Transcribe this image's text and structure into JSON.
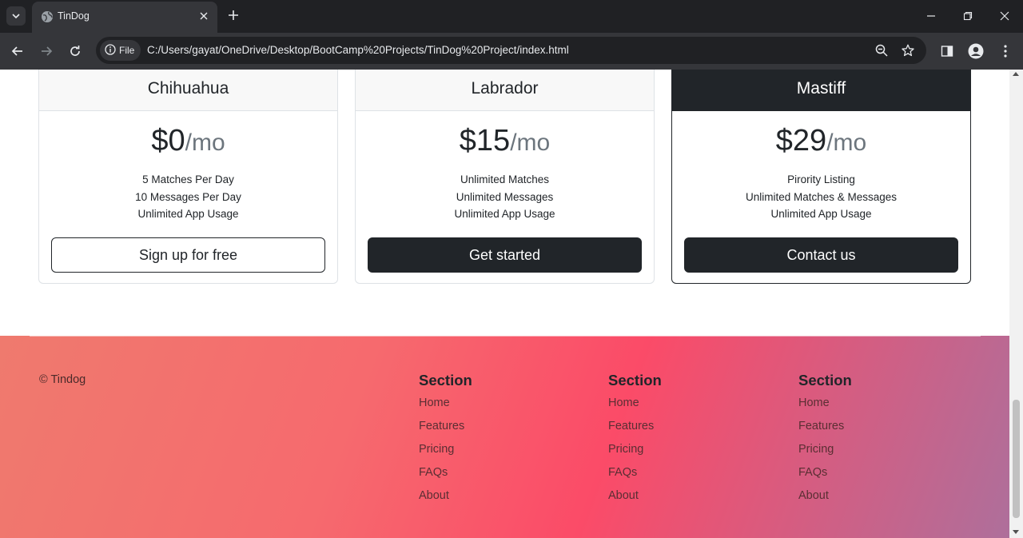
{
  "browser": {
    "tab_title": "TinDog",
    "file_chip_label": "File",
    "url": "C:/Users/gayat/OneDrive/Desktop/BootCamp%20Projects/TinDog%20Project/index.html"
  },
  "pricing": {
    "plans": [
      {
        "name": "Chihuahua",
        "price": "$0",
        "unit": "/mo",
        "features": [
          "5 Matches Per Day",
          "10 Messages Per Day",
          "Unlimited App Usage"
        ],
        "button": "Sign up for free"
      },
      {
        "name": "Labrador",
        "price": "$15",
        "unit": "/mo",
        "features": [
          "Unlimited Matches",
          "Unlimited Messages",
          "Unlimited App Usage"
        ],
        "button": "Get started"
      },
      {
        "name": "Mastiff",
        "price": "$29",
        "unit": "/mo",
        "features": [
          "Pirority Listing",
          "Unlimited Matches & Messages",
          "Unlimited App Usage"
        ],
        "button": "Contact us"
      }
    ]
  },
  "footer": {
    "copyright": "© Tindog",
    "columns": [
      {
        "heading": "Section",
        "links": [
          "Home",
          "Features",
          "Pricing",
          "FAQs",
          "About"
        ]
      },
      {
        "heading": "Section",
        "links": [
          "Home",
          "Features",
          "Pricing",
          "FAQs",
          "About"
        ]
      },
      {
        "heading": "Section",
        "links": [
          "Home",
          "Features",
          "Pricing",
          "FAQs",
          "About"
        ]
      }
    ]
  },
  "colors": {
    "dark": "#212529",
    "footer_gradient": [
      "#ef7a6e",
      "#fb4b68",
      "#ae6f9b"
    ]
  },
  "icons": [
    "tab-list-icon",
    "globe-icon",
    "close-icon",
    "plus-icon",
    "minimize-icon",
    "restore-icon",
    "window-close-icon",
    "back-arrow-icon",
    "forward-arrow-icon",
    "reload-icon",
    "info-icon",
    "zoom-icon",
    "star-icon",
    "side-panel-icon",
    "profile-icon",
    "menu-dots-icon"
  ]
}
